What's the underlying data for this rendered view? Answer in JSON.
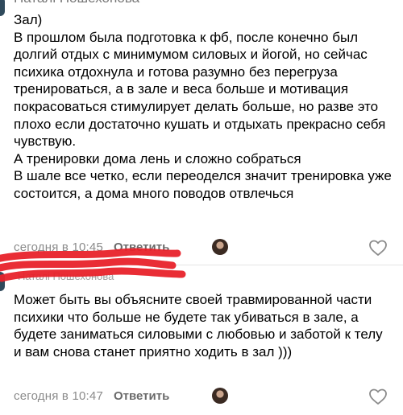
{
  "comment1": {
    "author": "Наталі Пошехонова",
    "paragraphs": [
      "Зал)",
      "В прошлом была подготовка к фб, после конечно был долгий отдых с минимумом силовых и йогой, но сейчас психика отдохнула и готова разумно без перегруза тренироваться, а в зале и веса больше и мотивация покрасоваться стимулирует делать больше, но разве это плохо если достаточно кушать и отдыхать прекрасно себя чувствую.",
      "А тренировки дома лень и сложно собраться",
      "В шале все четко, если переоделся значит тренировка уже состоится, а дома много поводов отвлечься"
    ],
    "time": "сегодня в 10:45",
    "reply_label": "Ответить",
    "heart_icon": "heart-outline-icon"
  },
  "comment2": {
    "author": "Наталі Пошехонова",
    "paragraphs": [
      "Может быть вы объясните своей травмированной части психики что больше не будете так убиваться в зале, а будете заниматься силовыми с любовью и заботой к телу и вам снова станет приятно ходить в зал )))"
    ],
    "time": "сегодня в 10:47",
    "reply_label": "Ответить",
    "heart_icon": "heart-outline-icon"
  },
  "colors": {
    "redaction": "#e8222a",
    "meta_text": "#8b8b8b",
    "reply": "#6a6a6a"
  }
}
